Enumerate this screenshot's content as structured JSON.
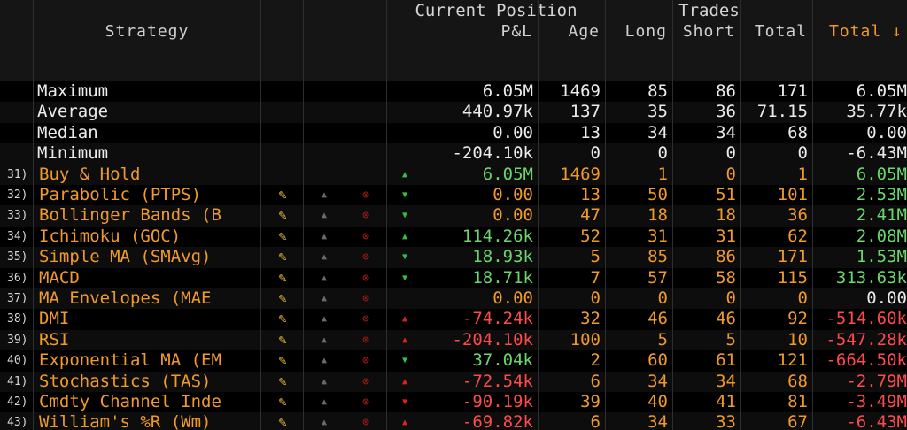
{
  "header": {
    "group_current_position": "Current Position",
    "group_trades": "Trades",
    "col_strategy": "Strategy",
    "col_pnl": "P&L",
    "col_age": "Age",
    "col_long": "Long",
    "col_short": "Short",
    "col_total": "Total",
    "col_total_highlight": "Total ↓"
  },
  "stats": [
    {
      "label": "Maximum",
      "pnl": "6.05M",
      "age": "1469",
      "long": "85",
      "short": "86",
      "total": "171",
      "total2": "6.05M"
    },
    {
      "label": "Average",
      "pnl": "440.97k",
      "age": "137",
      "long": "35",
      "short": "36",
      "total": "71.15",
      "total2": "35.77k"
    },
    {
      "label": "Median",
      "pnl": "0.00",
      "age": "13",
      "long": "34",
      "short": "34",
      "total": "68",
      "total2": "0.00"
    },
    {
      "label": "Minimum",
      "pnl": "-204.10k",
      "age": "0",
      "long": "0",
      "short": "0",
      "total": "0",
      "total2": "-6.43M"
    }
  ],
  "strategies": [
    {
      "index": "31)",
      "name": "Buy & Hold",
      "trend": "up-green",
      "pnl": "6.05M",
      "age": "1469",
      "long": "1",
      "short": "0",
      "total": "1",
      "total2": "6.05M"
    },
    {
      "index": "32)",
      "name": "Parabolic (PTPS)",
      "trend": "down-green",
      "pnl": "0.00",
      "age": "13",
      "long": "50",
      "short": "51",
      "total": "101",
      "total2": "2.53M"
    },
    {
      "index": "33)",
      "name": "Bollinger Bands (B",
      "trend": "down-green",
      "pnl": "0.00",
      "age": "47",
      "long": "18",
      "short": "18",
      "total": "36",
      "total2": "2.41M"
    },
    {
      "index": "34)",
      "name": "Ichimoku (GOC)",
      "trend": "up-green",
      "pnl": "114.26k",
      "age": "52",
      "long": "31",
      "short": "31",
      "total": "62",
      "total2": "2.08M"
    },
    {
      "index": "35)",
      "name": "Simple MA (SMAvg)",
      "trend": "down-green",
      "pnl": "18.93k",
      "age": "5",
      "long": "85",
      "short": "86",
      "total": "171",
      "total2": "1.53M"
    },
    {
      "index": "36)",
      "name": "MACD",
      "trend": "down-green",
      "pnl": "18.71k",
      "age": "7",
      "long": "57",
      "short": "58",
      "total": "115",
      "total2": "313.63k"
    },
    {
      "index": "37)",
      "name": "MA Envelopes (MAE",
      "trend": "none",
      "pnl": "0.00",
      "age": "0",
      "long": "0",
      "short": "0",
      "total": "0",
      "total2": "0.00"
    },
    {
      "index": "38)",
      "name": "DMI",
      "trend": "up-red",
      "pnl": "-74.24k",
      "age": "32",
      "long": "46",
      "short": "46",
      "total": "92",
      "total2": "-514.60k"
    },
    {
      "index": "39)",
      "name": "RSI",
      "trend": "up-red",
      "pnl": "-204.10k",
      "age": "100",
      "long": "5",
      "short": "5",
      "total": "10",
      "total2": "-547.28k"
    },
    {
      "index": "40)",
      "name": "Exponential MA (EM",
      "trend": "down-green",
      "pnl": "37.04k",
      "age": "2",
      "long": "60",
      "short": "61",
      "total": "121",
      "total2": "-664.50k"
    },
    {
      "index": "41)",
      "name": "Stochastics (TAS)",
      "trend": "up-red",
      "pnl": "-72.54k",
      "age": "6",
      "long": "34",
      "short": "34",
      "total": "68",
      "total2": "-2.79M"
    },
    {
      "index": "42)",
      "name": "Cmdty Channel Inde",
      "trend": "down-red",
      "pnl": "-90.19k",
      "age": "39",
      "long": "40",
      "short": "41",
      "total": "81",
      "total2": "-3.49M"
    },
    {
      "index": "43)",
      "name": "William's %R (Wm)",
      "trend": "up-red",
      "pnl": "-69.82k",
      "age": "6",
      "long": "34",
      "short": "33",
      "total": "67",
      "total2": "-6.43M"
    }
  ],
  "icons": {
    "edit": "pencil-icon",
    "alert": "bell-icon",
    "remove": "x-circle-icon",
    "trend_up": "triangle-up-icon",
    "trend_down": "triangle-down-icon"
  },
  "colors": {
    "orange": "#f09a2a",
    "green": "#6ad76a",
    "red": "#ff4a4a",
    "white": "#ececec"
  }
}
